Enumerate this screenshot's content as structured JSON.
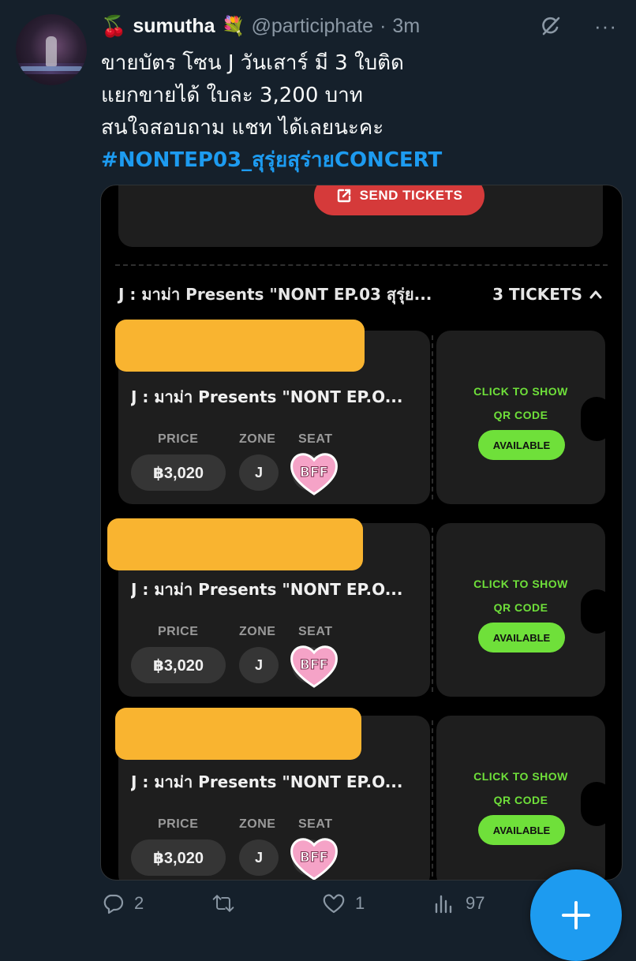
{
  "tweet": {
    "cherry_emoji": "🍒",
    "display_name": "sumutha",
    "bouquet_emoji": "💐",
    "handle": "@participhate",
    "separator": "·",
    "time": "3m",
    "more_label": "···",
    "lines": [
      "ขายบัตร โซน J วันเสาร์ มี 3 ใบติด",
      "แยกขายได้ ใบละ 3,200 บาท",
      "สนใจสอบถาม แชท ได้เลยนะคะ"
    ],
    "hashtag": "#NONTEP03_สุรุ่ยสุร่ายCONCERT"
  },
  "media": {
    "send_tickets_label": "SEND TICKETS",
    "event_title": "J : มาม่า Presents \"NONT EP.03 สุรุ่ย...",
    "ticket_count": "3 TICKETS",
    "tickets": [
      {
        "title": "J : มาม่า Presents \"NONT EP.O...",
        "price_label": "PRICE",
        "zone_label": "ZONE",
        "seat_label": "SEAT",
        "price": "฿3,020",
        "zone": "J",
        "seat": "BFF",
        "click_label": "CLICK TO SHOW",
        "qr_label": "QR CODE",
        "status": "AVAILABLE"
      },
      {
        "title": "J : มาม่า Presents \"NONT EP.O...",
        "price_label": "PRICE",
        "zone_label": "ZONE",
        "seat_label": "SEAT",
        "price": "฿3,020",
        "zone": "J",
        "seat": "BFF",
        "click_label": "CLICK TO SHOW",
        "qr_label": "QR CODE",
        "status": "AVAILABLE"
      },
      {
        "title": "J : มาม่า Presents \"NONT EP.O...",
        "price_label": "PRICE",
        "zone_label": "ZONE",
        "seat_label": "SEAT",
        "price": "฿3,020",
        "zone": "J",
        "seat": "BFF",
        "click_label": "CLICK TO SHOW",
        "qr_label": "QR CODE",
        "status": "AVAILABLE"
      }
    ]
  },
  "actions": {
    "replies": "2",
    "retweets": "",
    "likes": "1",
    "views": "97"
  },
  "colors": {
    "background": "#15202b",
    "accent": "#1d9bf0",
    "send_button": "#d53a3a",
    "available": "#6fe03a",
    "redaction": "#f9b430",
    "seat_heart": "#f5a3c7"
  },
  "icons": [
    "cherry-emoji",
    "bouquet-emoji",
    "grok-icon",
    "more-icon",
    "external-link-icon",
    "chevron-up-icon",
    "heart-sticker-icon",
    "reply-icon",
    "retweet-icon",
    "like-icon",
    "views-icon",
    "compose-plus-icon"
  ]
}
